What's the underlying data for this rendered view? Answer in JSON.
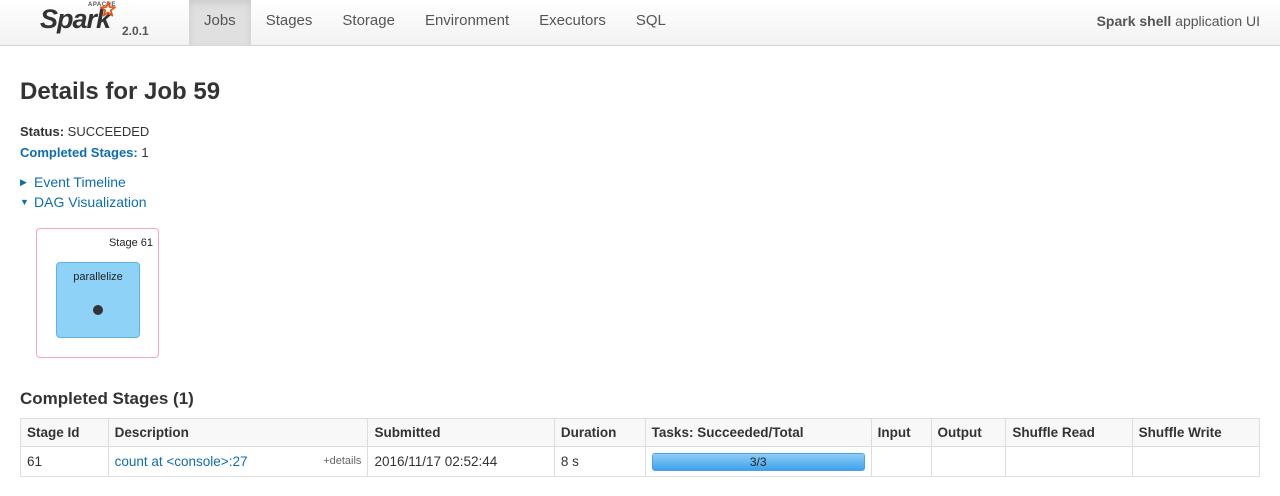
{
  "brand": {
    "apache": "APACHE",
    "name": "Spark",
    "version": "2.0.1"
  },
  "nav": {
    "items": [
      {
        "label": "Jobs",
        "active": true
      },
      {
        "label": "Stages",
        "active": false
      },
      {
        "label": "Storage",
        "active": false
      },
      {
        "label": "Environment",
        "active": false
      },
      {
        "label": "Executors",
        "active": false
      },
      {
        "label": "SQL",
        "active": false
      }
    ],
    "app_name": "Spark shell",
    "app_suffix": " application UI"
  },
  "page": {
    "title": "Details for Job 59",
    "status_label": "Status:",
    "status_value": " SUCCEEDED",
    "completed_stages_label": "Completed Stages:",
    "completed_stages_value": " 1",
    "event_timeline": "Event Timeline",
    "dag_visualization": "DAG Visualization"
  },
  "dag": {
    "stage_label": "Stage 61",
    "rdd_label": "parallelize"
  },
  "completed_stages": {
    "title": "Completed Stages (1)",
    "columns": [
      "Stage Id",
      "Description",
      "Submitted",
      "Duration",
      "Tasks: Succeeded/Total",
      "Input",
      "Output",
      "Shuffle Read",
      "Shuffle Write"
    ],
    "rows": [
      {
        "stage_id": "61",
        "description": "count at <console>:27",
        "details": "+details",
        "submitted": "2016/11/17 02:52:44",
        "duration": "8 s",
        "tasks": "3/3",
        "tasks_fraction": 1.0,
        "input": "",
        "output": "",
        "shuffle_read": "",
        "shuffle_write": ""
      }
    ]
  },
  "colors": {
    "link": "#0e6db1",
    "stage_border": "#f4a5c0",
    "rdd_fill": "#8fd2f8",
    "progress": "#4aa9ef"
  }
}
